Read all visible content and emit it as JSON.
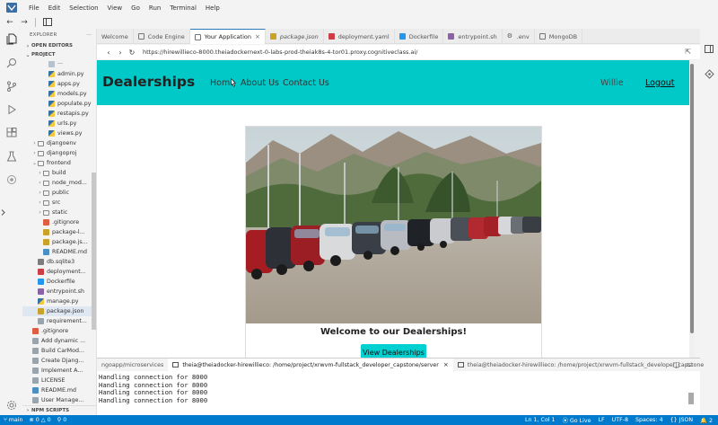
{
  "menubar": {
    "items": [
      "File",
      "Edit",
      "Selection",
      "View",
      "Go",
      "Run",
      "Terminal",
      "Help"
    ]
  },
  "sidebar": {
    "title": "EXPLORER",
    "more": "···",
    "open_editors": "OPEN EDITORS",
    "project": "PROJECT",
    "npm_scripts": "NPM SCRIPTS",
    "tree": [
      {
        "label": "···",
        "kind": "plain",
        "depth": 3
      },
      {
        "label": "admin.py",
        "kind": "py",
        "depth": 3
      },
      {
        "label": "apps.py",
        "kind": "py",
        "depth": 3
      },
      {
        "label": "models.py",
        "kind": "py",
        "depth": 3
      },
      {
        "label": "populate.py",
        "kind": "py",
        "depth": 3
      },
      {
        "label": "restapis.py",
        "kind": "py",
        "depth": 3
      },
      {
        "label": "urls.py",
        "kind": "py",
        "depth": 3
      },
      {
        "label": "views.py",
        "kind": "py",
        "depth": 3
      },
      {
        "label": "djangoenv",
        "kind": "folder",
        "depth": 1,
        "chev": "›"
      },
      {
        "label": "djangoproj",
        "kind": "folder",
        "depth": 1,
        "chev": "›"
      },
      {
        "label": "frontend",
        "kind": "folder",
        "depth": 1,
        "chev": "⌄"
      },
      {
        "label": "build",
        "kind": "folder",
        "depth": 2,
        "chev": "›"
      },
      {
        "label": "node_mod...",
        "kind": "folder",
        "depth": 2,
        "chev": "›"
      },
      {
        "label": "public",
        "kind": "folder",
        "depth": 2,
        "chev": "›"
      },
      {
        "label": "src",
        "kind": "folder",
        "depth": 2,
        "chev": "›"
      },
      {
        "label": "static",
        "kind": "folder",
        "depth": 2,
        "chev": "›"
      },
      {
        "label": ".gitignore",
        "kind": "git",
        "depth": 2
      },
      {
        "label": "package-l...",
        "kind": "json",
        "depth": 2
      },
      {
        "label": "package.js...",
        "kind": "json",
        "depth": 2
      },
      {
        "label": "README.md",
        "kind": "md",
        "depth": 2
      },
      {
        "label": "db.sqlite3",
        "kind": "db",
        "depth": 1
      },
      {
        "label": "deployment...",
        "kind": "yaml",
        "depth": 1
      },
      {
        "label": "Dockerfile",
        "kind": "docker",
        "depth": 1
      },
      {
        "label": "entrypoint.sh",
        "kind": "sh",
        "depth": 1
      },
      {
        "label": "manage.py",
        "kind": "py",
        "depth": 1
      },
      {
        "label": "package.json",
        "kind": "json",
        "depth": 1,
        "selected": true
      },
      {
        "label": "requirement...",
        "kind": "txt",
        "depth": 1
      },
      {
        "label": ".gitignore",
        "kind": "git",
        "depth": 0
      },
      {
        "label": "Add dynamic ...",
        "kind": "txt",
        "depth": 0
      },
      {
        "label": "Build CarMod...",
        "kind": "txt",
        "depth": 0
      },
      {
        "label": "Create Djang...",
        "kind": "txt",
        "depth": 0
      },
      {
        "label": "Implement A...",
        "kind": "txt",
        "depth": 0
      },
      {
        "label": "LICENSE",
        "kind": "txt",
        "depth": 0
      },
      {
        "label": "README.md",
        "kind": "md",
        "depth": 0
      },
      {
        "label": "User Manage...",
        "kind": "txt",
        "depth": 0
      }
    ]
  },
  "tabs": [
    {
      "label": "Welcome",
      "icon": "none",
      "active": false
    },
    {
      "label": "Code Engine",
      "icon": "grid-icon",
      "active": false
    },
    {
      "label": "Your Application",
      "icon": "browser-icon",
      "active": true,
      "closable": true
    },
    {
      "label": "package.json",
      "icon": "json",
      "active": false,
      "italic": true
    },
    {
      "label": "deployment.yaml",
      "icon": "yaml",
      "active": false
    },
    {
      "label": "Dockerfile",
      "icon": "docker",
      "active": false
    },
    {
      "label": "entrypoint.sh",
      "icon": "sh",
      "active": false
    },
    {
      "label": ".env",
      "icon": "gear-icon",
      "active": false
    },
    {
      "label": "MongoDB",
      "icon": "grid-icon",
      "active": false
    }
  ],
  "browser": {
    "url": "https://hirewillieco-8000.theiadockernext-0-labs-prod-theiak8s-4-tor01.proxy.cognitiveclass.ai/"
  },
  "site": {
    "brand": "Dealerships",
    "links": [
      "Home",
      "About Us",
      "Contact Us"
    ],
    "user": "Willie",
    "logout": "Logout",
    "card_title": "Welcome to our Dealerships!",
    "cta": "View Dealerships",
    "colors": {
      "nav": "#00c9c8",
      "button": "#00d0cf"
    }
  },
  "terminal": {
    "tabs": [
      {
        "label": "ngoapp/microservices",
        "active": false
      },
      {
        "label": "theia@theiadocker-hirewillieco: /home/project/xrwvm-fullstack_developer_capstone/server",
        "active": true
      },
      {
        "label": "theia@theiadocker-hirewillieco: /home/project/xrwvm-fullstack_developer_capstone",
        "active": false
      }
    ],
    "lines": [
      "Handling connection for 8000",
      "Handling connection for 8000",
      "Handling connection for 8000",
      "Handling connection for 8000"
    ]
  },
  "statusbar": {
    "branch": "main",
    "problems": "0 △ 0",
    "ports": "0",
    "position": "Ln 1, Col 1",
    "golive": "Go Live",
    "eol": "LF",
    "encoding": "UTF-8",
    "spaces": "Spaces: 4",
    "language": "JSON",
    "notifications": "2"
  }
}
